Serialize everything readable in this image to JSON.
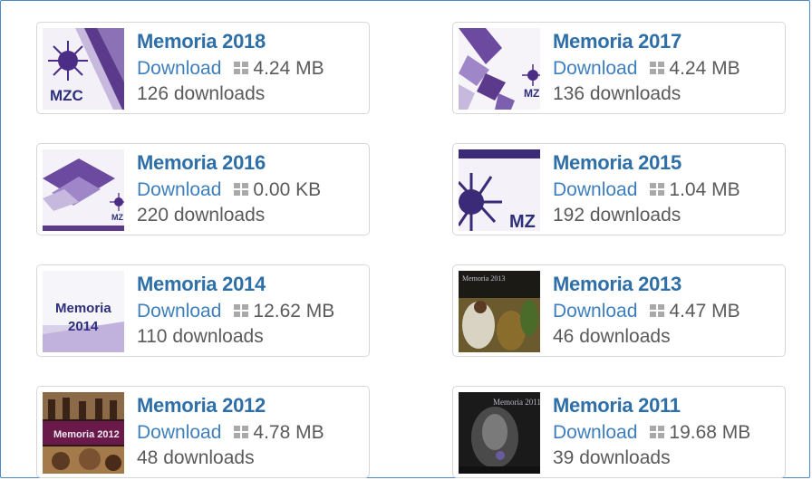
{
  "items": [
    {
      "title": "Memoria 2018",
      "download_label": "Download",
      "size": "4.24 MB",
      "downloads": "126 downloads",
      "thumb_text": "MZC"
    },
    {
      "title": "Memoria 2017",
      "download_label": "Download",
      "size": "4.24 MB",
      "downloads": "136 downloads",
      "thumb_text": "MZ"
    },
    {
      "title": "Memoria 2016",
      "download_label": "Download",
      "size": "0.00 KB",
      "downloads": "220 downloads",
      "thumb_text": "MZ"
    },
    {
      "title": "Memoria 2015",
      "download_label": "Download",
      "size": "1.04 MB",
      "downloads": "192 downloads",
      "thumb_text": "MZ"
    },
    {
      "title": "Memoria 2014",
      "download_label": "Download",
      "size": "12.62 MB",
      "downloads": "110 downloads",
      "thumb_text": "Memoria",
      "thumb_year": "2014"
    },
    {
      "title": "Memoria 2013",
      "download_label": "Download",
      "size": "4.47 MB",
      "downloads": "46 downloads",
      "thumb_text": "Memoria 2013"
    },
    {
      "title": "Memoria 2012",
      "download_label": "Download",
      "size": "4.78 MB",
      "downloads": "48 downloads",
      "thumb_text": "Memoria 2012"
    },
    {
      "title": "Memoria 2011",
      "download_label": "Download",
      "size": "19.68 MB",
      "downloads": "39 downloads",
      "thumb_text": "Memoria 2011"
    }
  ],
  "colors": {
    "accent": "#2f6fa8",
    "link": "#3d7fbf",
    "purple": "#5b3a8c",
    "border": "#d7d7d7",
    "frame": "#4a86c8"
  }
}
